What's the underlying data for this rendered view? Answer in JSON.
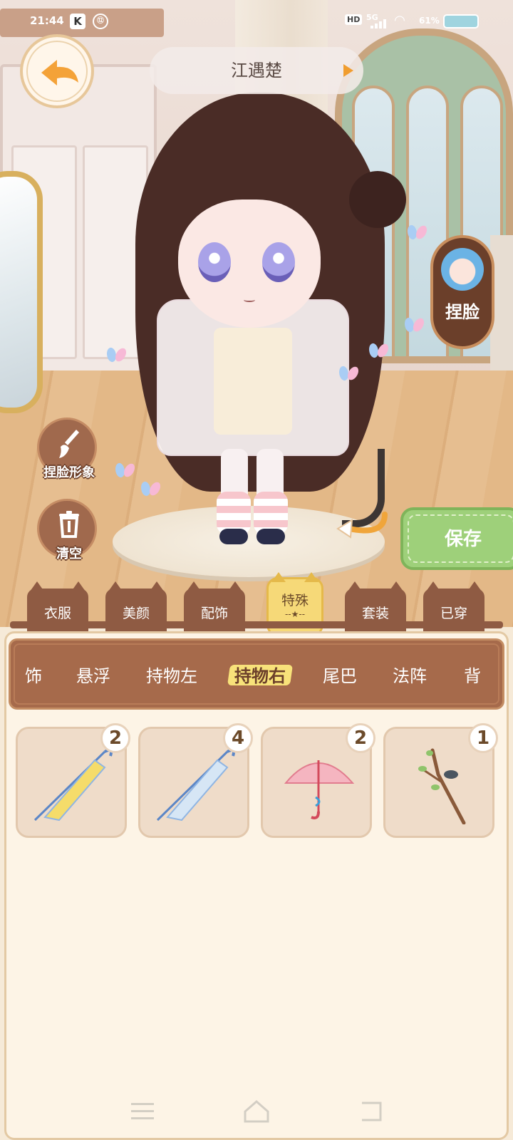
{
  "status_bar": {
    "time": "21:44",
    "app_icon": "K",
    "misc_icon": "⑫",
    "hd": "HD",
    "network": "5G",
    "battery": "61%"
  },
  "header": {
    "character_name": "江遇楚"
  },
  "buttons": {
    "pinch_face": "捏脸",
    "pinch_face_image": "捏脸形象",
    "clear": "清空",
    "save": "保存"
  },
  "tabs": [
    {
      "label": "衣服"
    },
    {
      "label": "美颜"
    },
    {
      "label": "配饰"
    },
    {
      "label": "特殊",
      "active": true
    },
    {
      "label": "套装"
    },
    {
      "label": "已穿"
    }
  ],
  "tab_active_decoration": "--★--",
  "subcategories": [
    {
      "label": "饰"
    },
    {
      "label": "悬浮"
    },
    {
      "label": "持物左"
    },
    {
      "label": "持物右",
      "active": true
    },
    {
      "label": "尾巴"
    },
    {
      "label": "法阵"
    },
    {
      "label": "背"
    }
  ],
  "items": [
    {
      "icon": "yellow-umbrella-icon",
      "count": "2"
    },
    {
      "icon": "clear-umbrella-icon",
      "count": "4"
    },
    {
      "icon": "pink-umbrella-icon",
      "count": "2"
    },
    {
      "icon": "branch-with-bird-icon",
      "count": "1"
    }
  ],
  "colors": {
    "accent_yellow": "#f6d978",
    "tab_brown": "#8f5b43",
    "save_green": "#9ed07a",
    "panel_bg": "#fdf4e6"
  }
}
